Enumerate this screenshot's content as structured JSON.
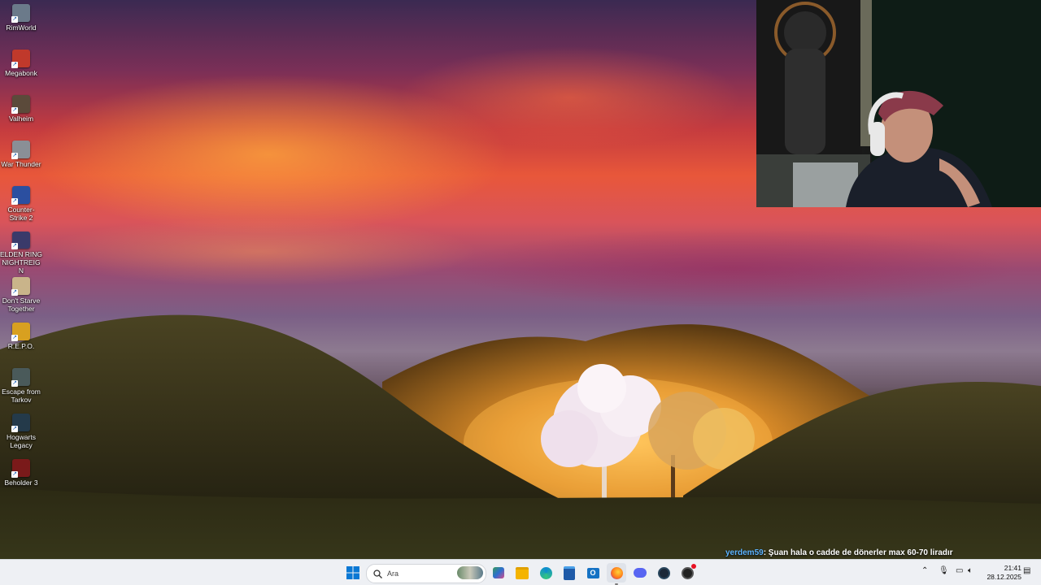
{
  "desktop_icons": [
    {
      "label": "RimWorld",
      "icon": "rimworld-icon",
      "color": "#6b7a8a"
    },
    {
      "label": "Megabonk",
      "icon": "megabonk-icon",
      "color": "#c0392b"
    },
    {
      "label": "Valheim",
      "icon": "valheim-icon",
      "color": "#5b4a3a"
    },
    {
      "label": "War Thunder",
      "icon": "war-thunder-icon",
      "color": "#8a8f96"
    },
    {
      "label": "Counter-Strike 2",
      "icon": "counter-strike-icon",
      "color": "#2b4fa0"
    },
    {
      "label": "ELDEN RING NIGHTREIGN",
      "icon": "elden-ring-icon",
      "color": "#3a3a6a"
    },
    {
      "label": "Don't Starve Together",
      "icon": "dont-starve-icon",
      "color": "#c9b48a"
    },
    {
      "label": "R.E.P.O.",
      "icon": "repo-icon",
      "color": "#d8a020"
    },
    {
      "label": "Escape from Tarkov",
      "icon": "tarkov-icon",
      "color": "#4a5a5a"
    },
    {
      "label": "Hogwarts Legacy",
      "icon": "hogwarts-icon",
      "color": "#243a4a"
    },
    {
      "label": "Beholder 3",
      "icon": "beholder-icon",
      "color": "#7a1a1a"
    }
  ],
  "chat": {
    "username": "yerdem59",
    "message": ": Şuan hala o cadde de dönerler max 60-70 liradır"
  },
  "taskbar": {
    "search_placeholder": "Ara",
    "apps": [
      {
        "name": "start-icon",
        "color": "#0a78d4"
      },
      {
        "name": "widgets-icon",
        "color": "#3a9a5a"
      },
      {
        "name": "file-explorer-icon",
        "color": "#f4b400"
      },
      {
        "name": "edge-icon",
        "color": "#0c8bd1"
      },
      {
        "name": "store-icon",
        "color": "#1e5aa8"
      },
      {
        "name": "outlook-icon",
        "color": "#1572c4"
      },
      {
        "name": "firefox-icon",
        "color": "#ff7a1a"
      },
      {
        "name": "discord-icon",
        "color": "#5865f2"
      },
      {
        "name": "steam-icon",
        "color": "#1b2838"
      },
      {
        "name": "obs-icon",
        "color": "#222222"
      }
    ],
    "clock": {
      "time": "21:41",
      "date": "28.12.2025"
    }
  },
  "colors": {
    "accent": "#0a78d4",
    "chat_username": "#5cb3ff"
  }
}
